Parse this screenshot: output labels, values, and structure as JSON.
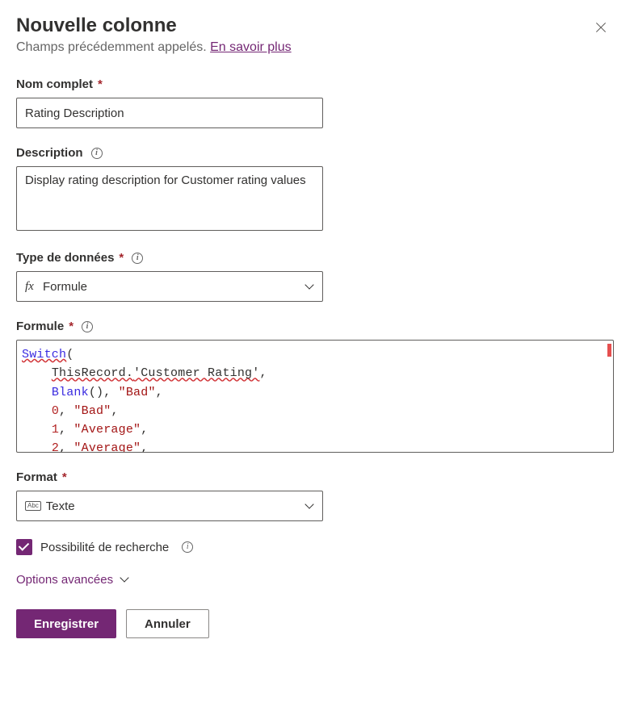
{
  "header": {
    "title": "Nouvelle colonne",
    "subtitle_prefix": "Champs précédemment appelés. ",
    "learn_more": "En savoir plus"
  },
  "display_name": {
    "label": "Nom complet",
    "value": "Rating Description"
  },
  "description": {
    "label": "Description",
    "value": "Display rating description for Customer rating values"
  },
  "data_type": {
    "label": "Type de données",
    "value": "Formule"
  },
  "formula": {
    "label": "Formule",
    "code": {
      "fn_switch": "Switch",
      "this_record": "ThisRecord.",
      "customer_rating": "'Customer Rating'",
      "fn_blank": "Blank",
      "str_bad": "\"Bad\"",
      "num0": "0",
      "num1": "1",
      "num2": "2",
      "str_average": "\"Average\""
    }
  },
  "format": {
    "label": "Format",
    "value": "Texte"
  },
  "searchable": {
    "label": "Possibilité de recherche",
    "checked": true
  },
  "advanced": {
    "label": "Options avancées"
  },
  "footer": {
    "save": "Enregistrer",
    "cancel": "Annuler"
  }
}
